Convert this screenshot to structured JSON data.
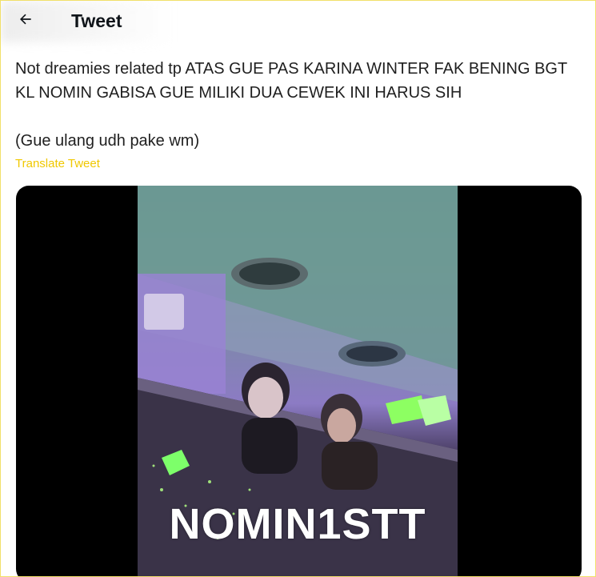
{
  "header": {
    "title": "Tweet",
    "back_icon": "arrow-left-icon"
  },
  "tweet": {
    "line1": "Not dreamies related tp ATAS GUE PAS KARINA WINTER FAK BENING BGT KL NOMIN GABISA GUE MILIKI DUA CEWEK INI HARUS SIH",
    "line2": "(Gue ulang udh pake wm)",
    "translate_label": "Translate Tweet"
  },
  "media": {
    "watermark": "NOMIN1STT"
  },
  "colors": {
    "accent": "#f0c800",
    "media_bg": "#000000",
    "frame_border": "#f1e06a"
  }
}
